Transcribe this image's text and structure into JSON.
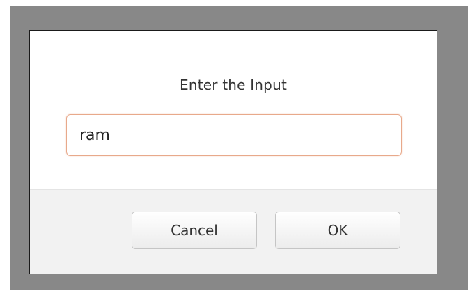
{
  "dialog": {
    "prompt": "Enter the Input",
    "input_value": "ram",
    "cancel_label": "Cancel",
    "ok_label": "OK"
  },
  "colors": {
    "backdrop": "#888888",
    "input_focus_border": "#e8a98b",
    "footer_background": "#f2f2f2"
  }
}
